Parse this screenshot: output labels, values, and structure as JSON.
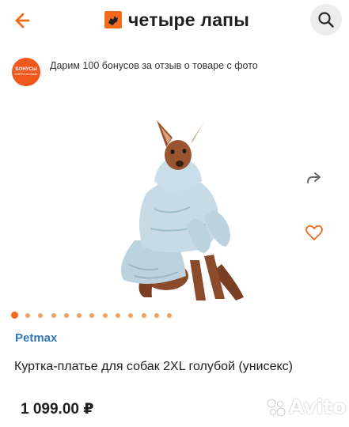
{
  "header": {
    "logo_text": "четыре лапы",
    "back_icon": "arrow-left-icon",
    "search_icon": "search-icon"
  },
  "promo": {
    "badge_text": "БОНУСЫ",
    "badge_subtext": "ЗАВТРА БОЛЬШЕ",
    "text": "Дарим 100 бонусов за отзыв о товаре с фото"
  },
  "gallery": {
    "slide_count": 13,
    "active_index": 0,
    "share_icon": "share-icon",
    "favorite_icon": "heart-icon"
  },
  "product": {
    "brand": "Petmax",
    "title": "Куртка-платье для собак 2XL голубой (унисекс)",
    "price": "1 099.00 ₽"
  },
  "watermark": {
    "text": "Avito"
  },
  "colors": {
    "accent": "#f26b1d",
    "brand_link": "#3479b8",
    "dot_inactive": "#f0a264",
    "text": "#1e1e1e"
  }
}
